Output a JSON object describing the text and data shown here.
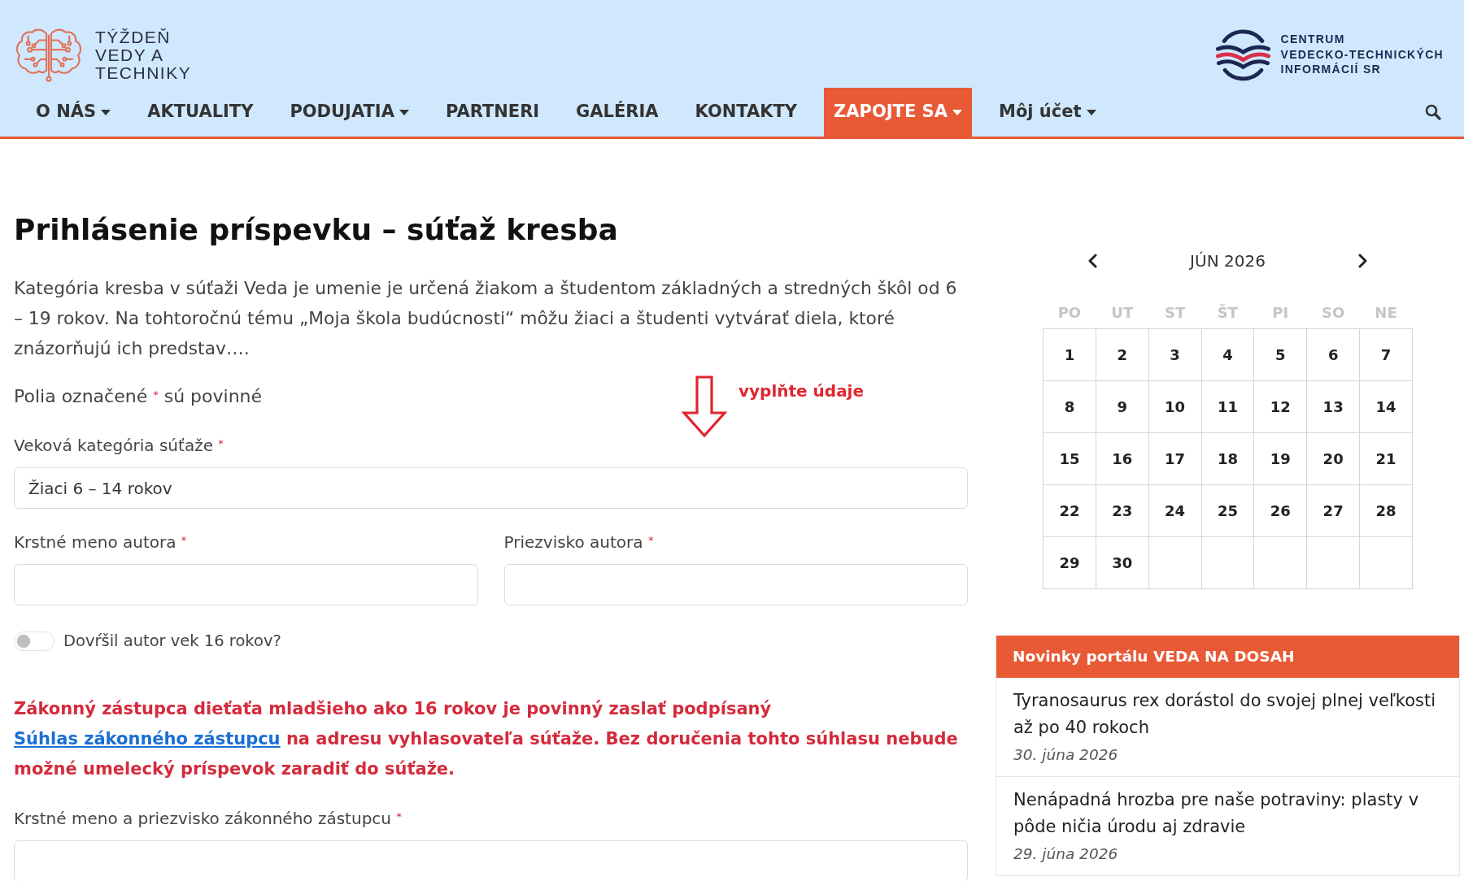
{
  "header": {
    "logo": {
      "lines": [
        "TÝŽDEŇ",
        "VEDY A",
        "TECHNIKY"
      ]
    },
    "partner_logo": {
      "lines": [
        "CENTRUM",
        "VEDECKO-TECHNICKÝCH",
        "INFORMÁCIÍ SR"
      ]
    }
  },
  "nav": {
    "items": [
      {
        "label": "O NÁS",
        "dropdown": true,
        "selected": false
      },
      {
        "label": "AKTUALITY",
        "dropdown": false,
        "selected": false
      },
      {
        "label": "PODUJATIA",
        "dropdown": true,
        "selected": false
      },
      {
        "label": "PARTNERI",
        "dropdown": false,
        "selected": false
      },
      {
        "label": "GALÉRIA",
        "dropdown": false,
        "selected": false
      },
      {
        "label": "KONTAKTY",
        "dropdown": false,
        "selected": false
      },
      {
        "label": "ZAPOJTE SA",
        "dropdown": true,
        "selected": true
      },
      {
        "label": "Môj účet",
        "dropdown": true,
        "selected": false
      }
    ]
  },
  "page": {
    "title": "Prihlásenie príspevku – súťaž kresba",
    "intro": "Kategória kresba v súťaži Veda je umenie je určená žiakom a študentom základných a stredných škôl od 6 – 19 rokov. Na tohtoročnú tému „Moja škola budúcnosti“ môžu žiaci a študenti vytvárať diela, ktoré znázorňujú ich predstav….",
    "required_note": {
      "before": "Polia označené",
      "mark": "*",
      "after": "sú povinné"
    },
    "annotation": {
      "text": "vyplňte údaje"
    },
    "form": {
      "rows": [
        {
          "fields": [
            {
              "kind": "select",
              "label": "Veková kategória súťaže",
              "required_mark": "*",
              "value": "Žiaci 6 – 14 rokov"
            }
          ]
        },
        {
          "fields": [
            {
              "kind": "text",
              "label": "Krstné meno autora",
              "required_mark": "*"
            },
            {
              "kind": "text",
              "label": "Priezvisko autora",
              "required_mark": "*"
            }
          ]
        },
        {
          "fields": [
            {
              "kind": "switch",
              "label": "Dovŕšil autor vek 16 rokov?",
              "on": false
            }
          ]
        },
        {
          "fields": [
            {
              "kind": "notice",
              "parts": [
                {
                  "kind": "text",
                  "text": "Zákonný zástupca dieťaťa mladšieho ako 16 rokov je povinný zaslať podpísaný"
                },
                {
                  "kind": "link",
                  "text": "Súhlas zákonného zástupcu"
                },
                {
                  "kind": "text",
                  "text": "na adresu vyhlasovateľa súťaže. Bez doručenia tohto súhlasu nebude možné umelecký príspevok zaradiť do súťaže."
                }
              ]
            }
          ]
        },
        {
          "fields": [
            {
              "kind": "text",
              "label": "Krstné meno a priezvisko zákonného zástupcu",
              "required_mark": "*"
            }
          ]
        }
      ]
    }
  },
  "sidebar": {
    "calendar": {
      "month": "JÚN 2026",
      "weekdays": [
        "PO",
        "UT",
        "ST",
        "ŠT",
        "PI",
        "SO",
        "NE"
      ],
      "weeks": [
        [
          "1",
          "2",
          "3",
          "4",
          "5",
          "6",
          "7"
        ],
        [
          "8",
          "9",
          "10",
          "11",
          "12",
          "13",
          "14"
        ],
        [
          "15",
          "16",
          "17",
          "18",
          "19",
          "20",
          "21"
        ],
        [
          "22",
          "23",
          "24",
          "25",
          "26",
          "27",
          "28"
        ],
        [
          "29",
          "30"
        ]
      ]
    },
    "news": {
      "title": "Novinky portálu VEDA NA DOSAH",
      "items": [
        {
          "headline": "Tyranosaurus rex dorástol do svojej plnej veľkosti až po 40 rokoch",
          "date": "30. júna 2026"
        },
        {
          "headline": "Nenápadná hrozba pre naše potraviny: plasty v pôde ničia úrodu aj zdravie",
          "date": "29. júna 2026"
        }
      ]
    }
  }
}
